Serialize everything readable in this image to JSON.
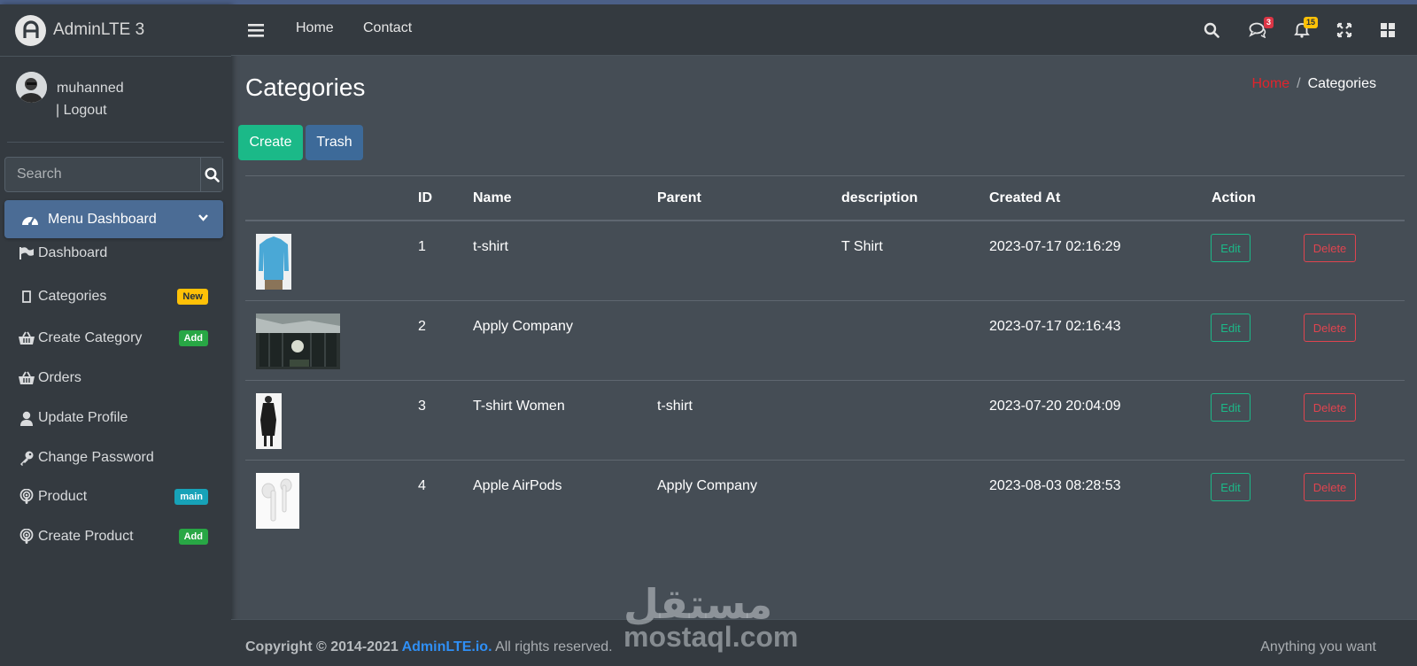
{
  "brand": {
    "name": "AdminLTE 3"
  },
  "user": {
    "name": "muhanned",
    "logout": "| Logout"
  },
  "sidebar": {
    "search_placeholder": "Search",
    "menu_header": "Menu Dashboard",
    "items": [
      {
        "label": "Dashboard",
        "icon": "flag-icon"
      },
      {
        "label": "Categories",
        "icon": "square-icon",
        "badge": "New",
        "badge_color": "#ffc107"
      },
      {
        "label": "Create Category",
        "icon": "basket-icon",
        "badge": "Add",
        "badge_color": "#28a745"
      },
      {
        "label": "Orders",
        "icon": "basket-icon"
      },
      {
        "label": "Update Profile",
        "icon": "user-icon"
      },
      {
        "label": "Change Password",
        "icon": "key-icon"
      },
      {
        "label": "Product",
        "icon": "podcast-icon",
        "badge": "main",
        "badge_color": "#17a2b8"
      },
      {
        "label": "Create Product",
        "icon": "podcast-icon",
        "badge": "Add",
        "badge_color": "#28a745"
      }
    ]
  },
  "navbar": {
    "links": [
      "Home",
      "Contact"
    ],
    "messages_count": "3",
    "notifications_count": "15"
  },
  "page": {
    "title": "Categories",
    "breadcrumb": {
      "home": "Home",
      "separator": "/",
      "current": "Categories"
    },
    "buttons": {
      "create": "Create",
      "trash": "Trash"
    }
  },
  "table": {
    "headers": [
      "",
      "ID",
      "Name",
      "Parent",
      "description",
      "Created At",
      "Action"
    ],
    "rows": [
      {
        "id": "1",
        "name": "t-shirt",
        "parent": "",
        "description": "T Shirt",
        "created_at": "2023-07-17 02:16:29",
        "edit": "Edit",
        "delete": "Delete"
      },
      {
        "id": "2",
        "name": "Apply Company",
        "parent": "",
        "description": "",
        "created_at": "2023-07-17 02:16:43",
        "edit": "Edit",
        "delete": "Delete"
      },
      {
        "id": "3",
        "name": "T-shirt Women",
        "parent": "t-shirt",
        "description": "",
        "created_at": "2023-07-20 20:04:09",
        "edit": "Edit",
        "delete": "Delete"
      },
      {
        "id": "4",
        "name": "Apple AirPods",
        "parent": "Apply Company",
        "description": "",
        "created_at": "2023-08-03 08:28:53",
        "edit": "Edit",
        "delete": "Delete"
      }
    ]
  },
  "footer": {
    "copyright_prefix": "Copyright © 2014-2021 ",
    "link": "AdminLTE.io.",
    "suffix": " All rights reserved.",
    "right": "Anything you want"
  },
  "watermark": {
    "arabic": "مستقل",
    "latin": "mostaql.com"
  }
}
